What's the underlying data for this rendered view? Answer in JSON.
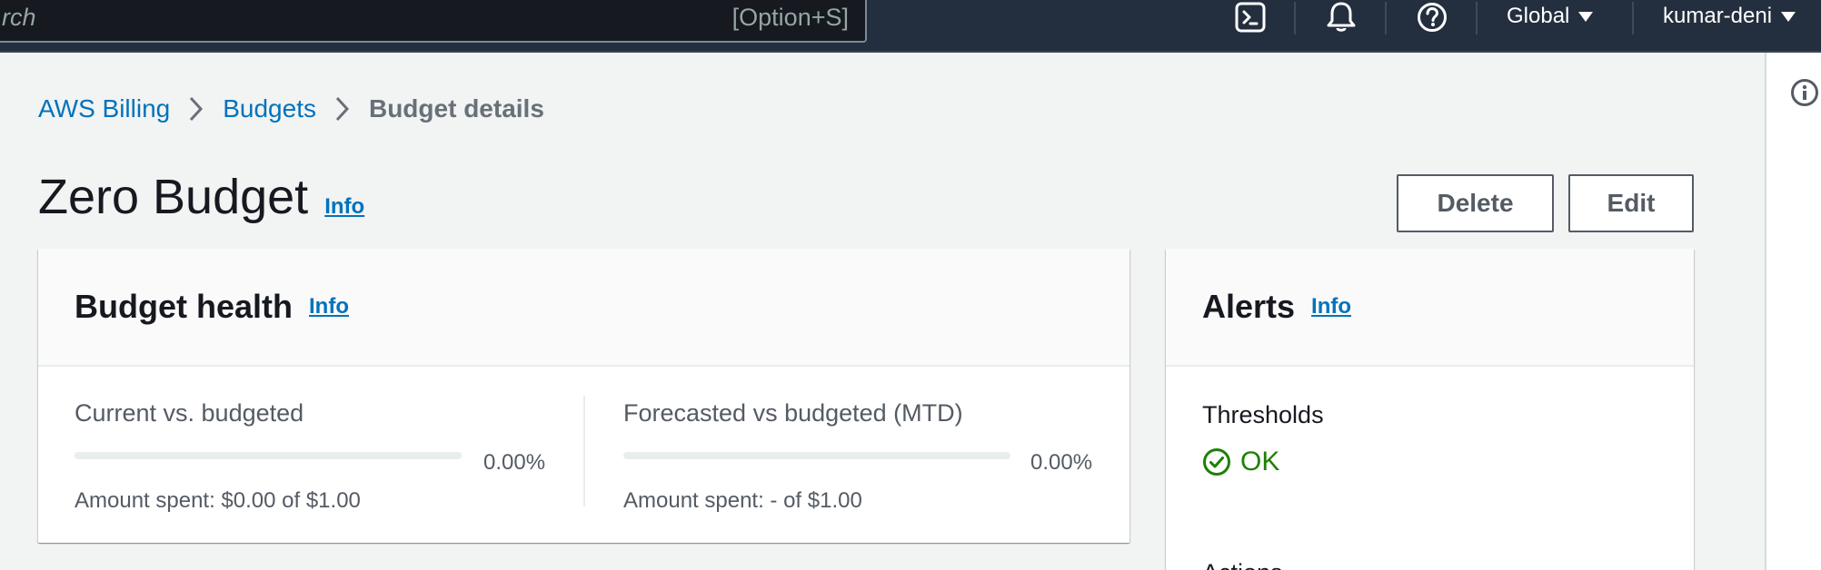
{
  "topnav": {
    "search_placeholder": "rch",
    "search_shortcut": "[Option+S]",
    "region_label": "Global",
    "account_label": "kumar-deni"
  },
  "breadcrumb": {
    "items": [
      "AWS Billing",
      "Budgets"
    ],
    "current": "Budget details"
  },
  "page": {
    "title": "Zero Budget",
    "info_label": "Info",
    "delete_label": "Delete",
    "edit_label": "Edit"
  },
  "budget_health": {
    "title": "Budget health",
    "info_label": "Info",
    "current": {
      "label": "Current vs. budgeted",
      "percent_text": "0.00%",
      "percent_value": 0,
      "amount_text": "Amount spent: $0.00 of $1.00"
    },
    "forecast": {
      "label": "Forecasted vs budgeted (MTD)",
      "percent_text": "0.00%",
      "percent_value": 0,
      "amount_text": "Amount spent: - of $1.00"
    }
  },
  "alerts": {
    "title": "Alerts",
    "info_label": "Info",
    "thresholds_label": "Thresholds",
    "status": "OK",
    "actions_label": "Actions"
  },
  "colors": {
    "nav_bg": "#232f3e",
    "link": "#0073bb",
    "ok": "#1d8102"
  },
  "icons": [
    "cloudshell-icon",
    "bell-icon",
    "help-icon",
    "info-circle-icon",
    "chevron-right-icon",
    "check-circle-icon",
    "caret-down-icon"
  ]
}
